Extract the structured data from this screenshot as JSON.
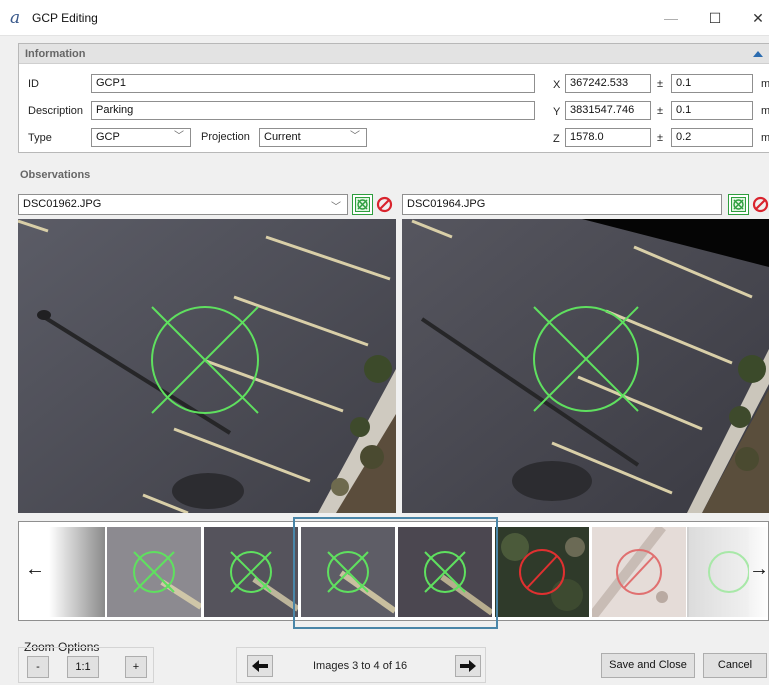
{
  "window": {
    "logo": "a",
    "title": "GCP Editing",
    "minimize": "—",
    "maximize": "☐",
    "close": "✕"
  },
  "information": {
    "title": "Information",
    "id_label": "ID",
    "id_value": "GCP1",
    "description_label": "Description",
    "description_value": "Parking",
    "type_label": "Type",
    "type_value": "GCP",
    "projection_label": "Projection",
    "projection_value": "Current",
    "x_label": "X",
    "x_value": "367242.533",
    "x_accuracy": "0.1",
    "y_label": "Y",
    "y_value": "3831547.746",
    "y_accuracy": "0.1",
    "z_label": "Z",
    "z_value": "1578.0",
    "z_accuracy": "0.2",
    "plusminus": "±",
    "unit": "m"
  },
  "observations": {
    "title": "Observations",
    "left_image": "DSC01962.JPG",
    "right_image": "DSC01964.JPG"
  },
  "filmstrip": {
    "left_arrow": "←",
    "right_arrow": "→"
  },
  "zoom": {
    "label": "Zoom Options",
    "minus": "-",
    "one_to_one": "1:1",
    "plus": "+"
  },
  "paging": {
    "text": "Images 3 to 4 of 16"
  },
  "actions": {
    "save_close": "Save and Close",
    "cancel": "Cancel"
  },
  "colors": {
    "marker_green": "#5fe05f",
    "marker_red": "#e03030"
  }
}
